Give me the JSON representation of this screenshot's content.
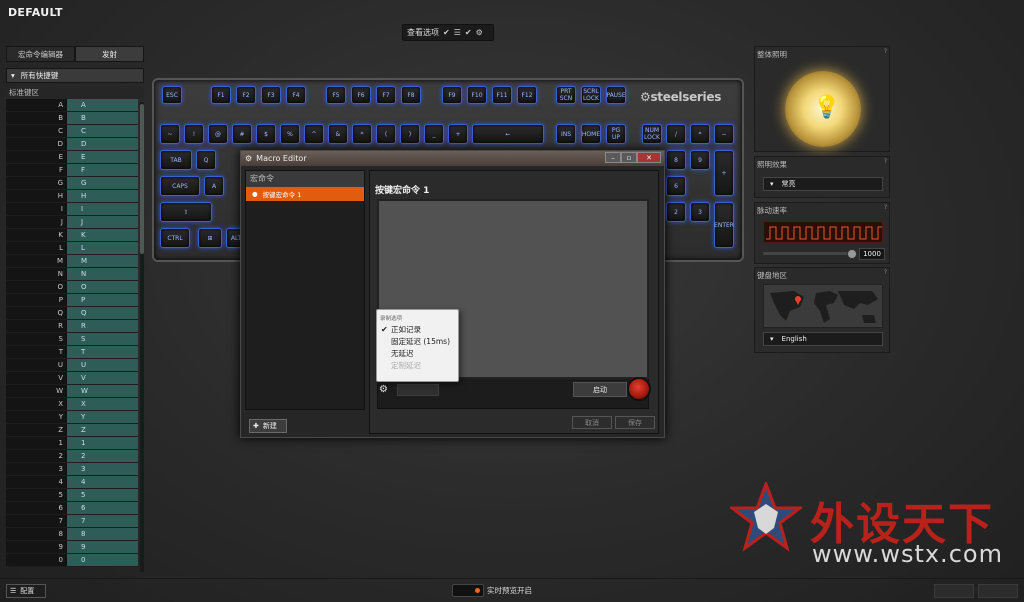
{
  "profile": {
    "title": "DEFAULT"
  },
  "view_options": {
    "label": "查看选项"
  },
  "left_panel": {
    "tabs": [
      {
        "label": "宏命令编辑器"
      },
      {
        "label": "发射"
      }
    ],
    "all_shortcuts_label": "所有快捷键",
    "std_keys_header": "标准键区",
    "keys": [
      "A",
      "B",
      "C",
      "D",
      "E",
      "F",
      "G",
      "H",
      "I",
      "J",
      "K",
      "L",
      "M",
      "N",
      "O",
      "P",
      "Q",
      "R",
      "S",
      "T",
      "U",
      "V",
      "W",
      "X",
      "Y",
      "Z",
      "1",
      "2",
      "3",
      "4",
      "5",
      "6",
      "7",
      "8",
      "9",
      "0"
    ]
  },
  "keyboard": {
    "brand": "steelseries",
    "row0": [
      "ESC",
      "F1",
      "F2",
      "F3",
      "F4",
      "F5",
      "F6",
      "F7",
      "F8",
      "F9",
      "F10",
      "F11",
      "F12",
      "PRT SCN",
      "SCRL LOCK",
      "PAUSE"
    ],
    "row1": [
      "~",
      "!",
      "@",
      "#",
      "$",
      "%",
      "^",
      "&",
      "*",
      "(",
      ")",
      "_",
      "+",
      "←",
      "INS",
      "HOME",
      "PG UP",
      "NUM LOCK",
      "/",
      "*",
      "−"
    ],
    "row2": [
      "TAB",
      "Q",
      "8",
      "9",
      "+"
    ],
    "row3": [
      "CAPS",
      "A",
      "5",
      "6"
    ],
    "row4": [
      "⇧",
      "2",
      "3",
      "ENTER"
    ],
    "row5": [
      "CTRL",
      "⊞",
      "ALT"
    ]
  },
  "macro_editor": {
    "title": "Macro Editor",
    "list_header": "宏命令",
    "item": "按键宏命令 1",
    "new_label": "新建",
    "macro_title": "按键宏命令 1",
    "start_label": "启动",
    "cancel_label": "取消",
    "save_label": "保存",
    "menu": {
      "title": "录制选项",
      "items": [
        {
          "label": "正如记录",
          "checked": true,
          "disabled": false
        },
        {
          "label": "固定延迟 (15ms)",
          "checked": false,
          "disabled": false
        },
        {
          "label": "无延迟",
          "checked": false,
          "disabled": false
        },
        {
          "label": "定制延迟",
          "checked": false,
          "disabled": true
        }
      ]
    }
  },
  "right_panel": {
    "illumination": {
      "title": "整体照明"
    },
    "effect": {
      "title": "照明效果",
      "value": "常亮"
    },
    "rate": {
      "title": "脉动速率",
      "value": "1000"
    },
    "region": {
      "title": "键盘地区",
      "value": "English"
    }
  },
  "bottom": {
    "config_label": "配置",
    "live_preview_label": "实时预览开启"
  },
  "watermark": {
    "text1": "外设天下",
    "text2": "www.wstx.com"
  },
  "colors": {
    "accent": "#e25c10",
    "key_glow": "#3d5fcf",
    "teal": "#2e5d57",
    "watermark_red": "#b8221b"
  }
}
